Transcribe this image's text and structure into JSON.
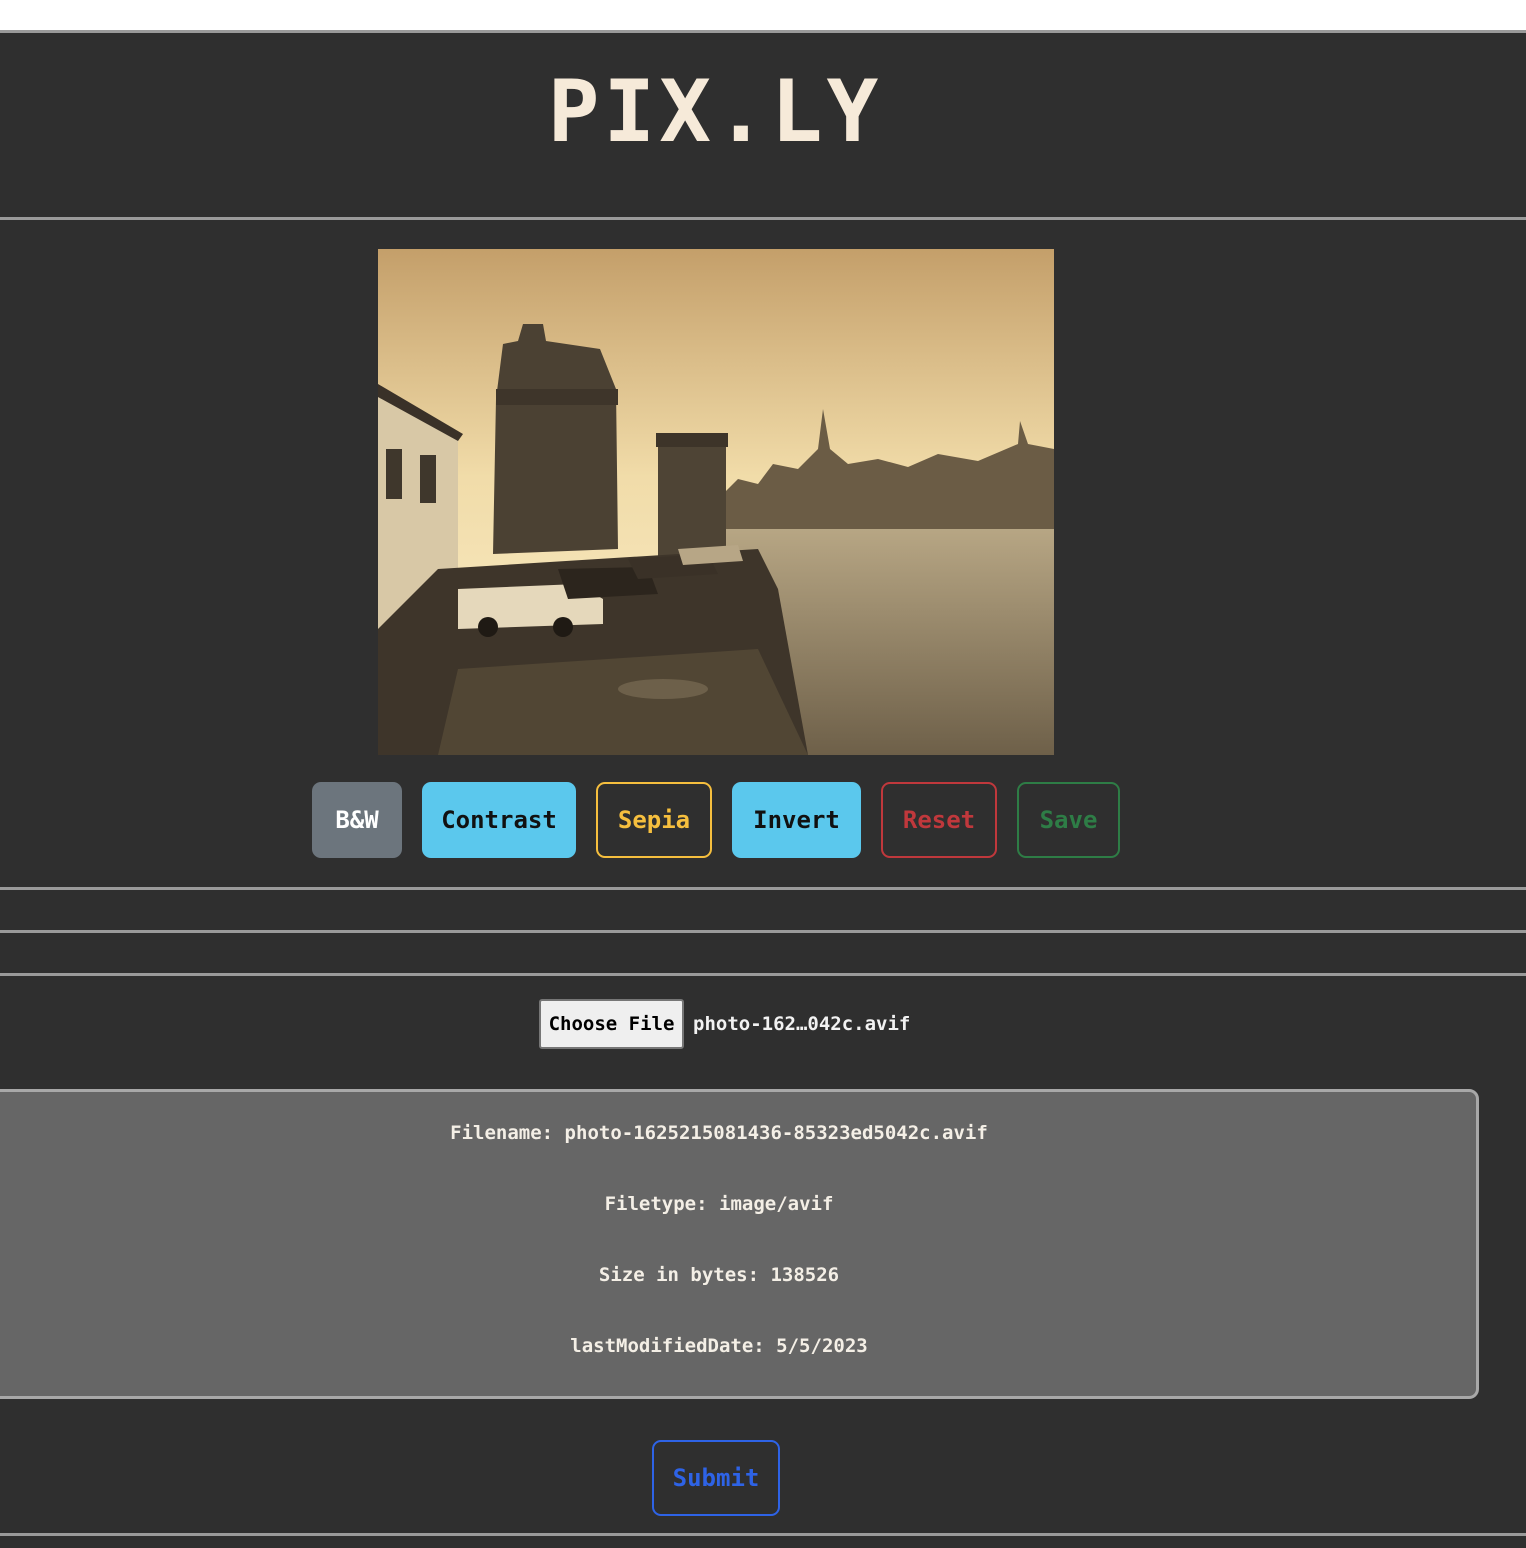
{
  "app": {
    "logo": "PIX.LY"
  },
  "editor": {
    "image_alt": "Sepia-toned photo of a harbor with stone towers, parked cars and water",
    "buttons": [
      {
        "label": "B&W",
        "variant": "secondary-filled"
      },
      {
        "label": "Contrast",
        "variant": "info-filled"
      },
      {
        "label": "Sepia",
        "variant": "warning-outline"
      },
      {
        "label": "Invert",
        "variant": "info-filled"
      },
      {
        "label": "Reset",
        "variant": "danger-outline"
      },
      {
        "label": "Save",
        "variant": "success-outline"
      }
    ]
  },
  "upload": {
    "choose_file_label": "Choose File",
    "selected_file": "photo-162…042c.avif"
  },
  "file_info": {
    "filename": "Filename: photo-1625215081436-85323ed5042c.avif",
    "filetype": "Filetype: image/avif",
    "size": "Size in bytes: 138526",
    "last_modified": "lastModifiedDate: 5/5/2023"
  },
  "form": {
    "submit_label": "Submit"
  },
  "colors": {
    "background": "#2f2f2f",
    "logo": "#f6ead9",
    "bw": "#6c757d",
    "info": "#5bc8ed",
    "warning": "#f6bf3e",
    "danger": "#c0383c",
    "success": "#2e7d46",
    "primary": "#2e63e6"
  }
}
